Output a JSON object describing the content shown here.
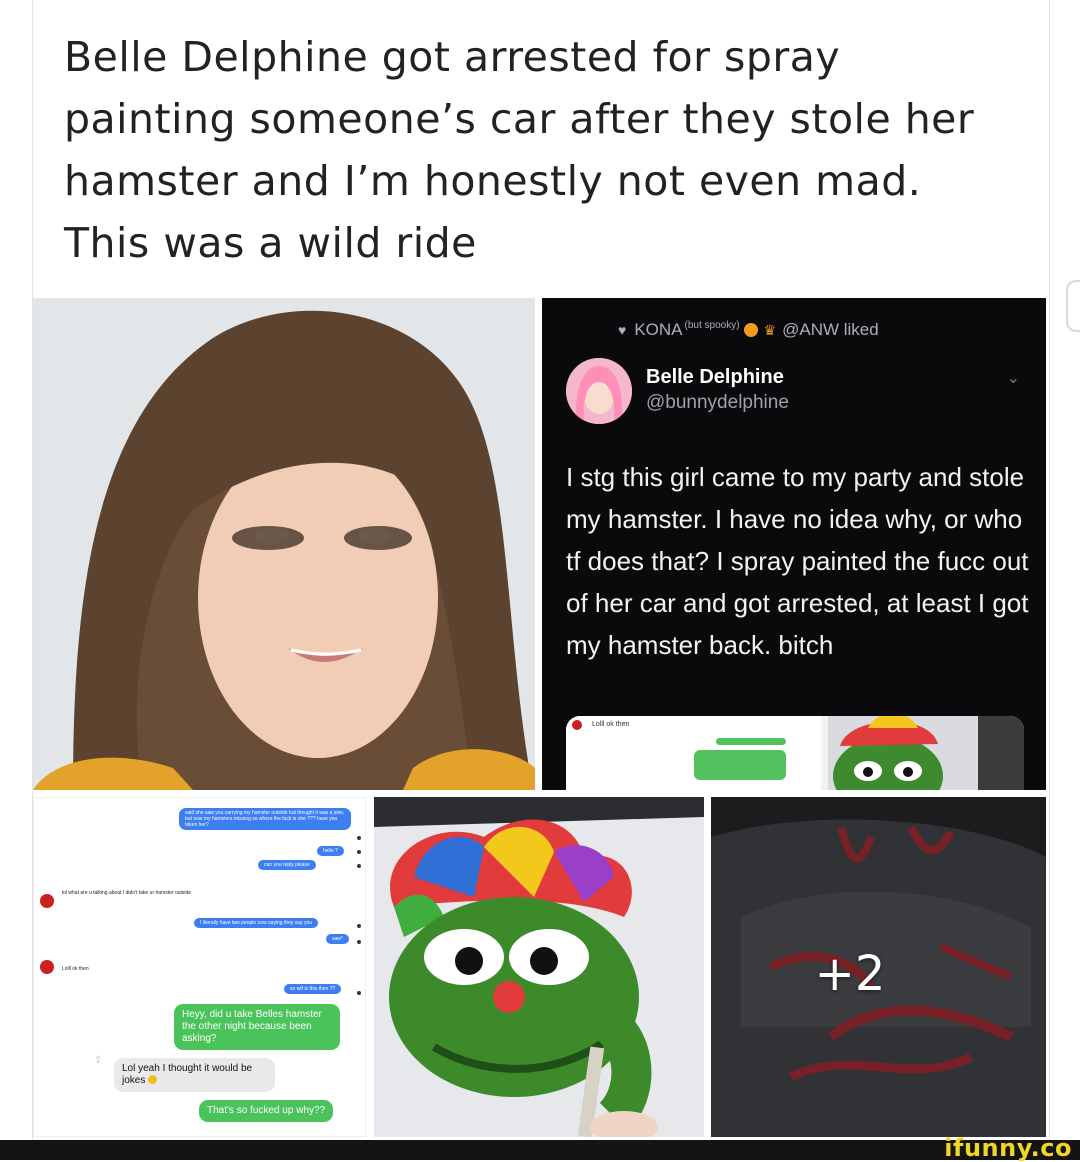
{
  "post": {
    "caption": "Belle Delphine got arrested for spray painting someone’s car after they stole her hamster and I’m honestly not even mad. This was a wild ride"
  },
  "tweet": {
    "liked_by": "KONA",
    "liked_by_sup": "(but spooky)",
    "liked_suffix": "@ANW liked",
    "display_name": "Belle Delphine",
    "handle": "@bunnydelphine",
    "text": "I stg this girl came to my party and stole my hamster. I have no idea why, or who tf does that? I spray painted the fucc out of her car and got arrested, at least I got my hamster back. bitch",
    "embed_text": "Lolll ok then"
  },
  "chat": {
    "outgoing_1": "said she saw you carrying my hamster outside but thought it was a joke, but now my hamsters missing so where the fuck is she ??? have you taken her?",
    "outgoing_2": "hello ?",
    "outgoing_3": "can you reply please",
    "incoming_1": "lol what are u talking about I didn't take ur hamster outside",
    "outgoing_4": "I literally have two people now saying they say you",
    "outgoing_5": "saw*",
    "incoming_2": "Lolll ok then",
    "outgoing_6": "so wtf is this then ??",
    "green_1": "Heyy, did u take Belles hamster the other night because been asking?",
    "incoming_3": "Lol yeah I thought it would be jokes",
    "green_2": "That's so fucked up why??"
  },
  "gallery": {
    "more_count": "+2"
  },
  "watermark": "ifunny.co",
  "colors": {
    "tweet_bg": "#0a0a0c",
    "imessage_blue": "#3d7ff0",
    "sms_green": "#4ac45a",
    "watermark_yellow": "#f2d624"
  },
  "icons": [
    "heart-icon",
    "pumpkin-icon",
    "crown-icon",
    "chevron-down-icon",
    "share-icon"
  ]
}
